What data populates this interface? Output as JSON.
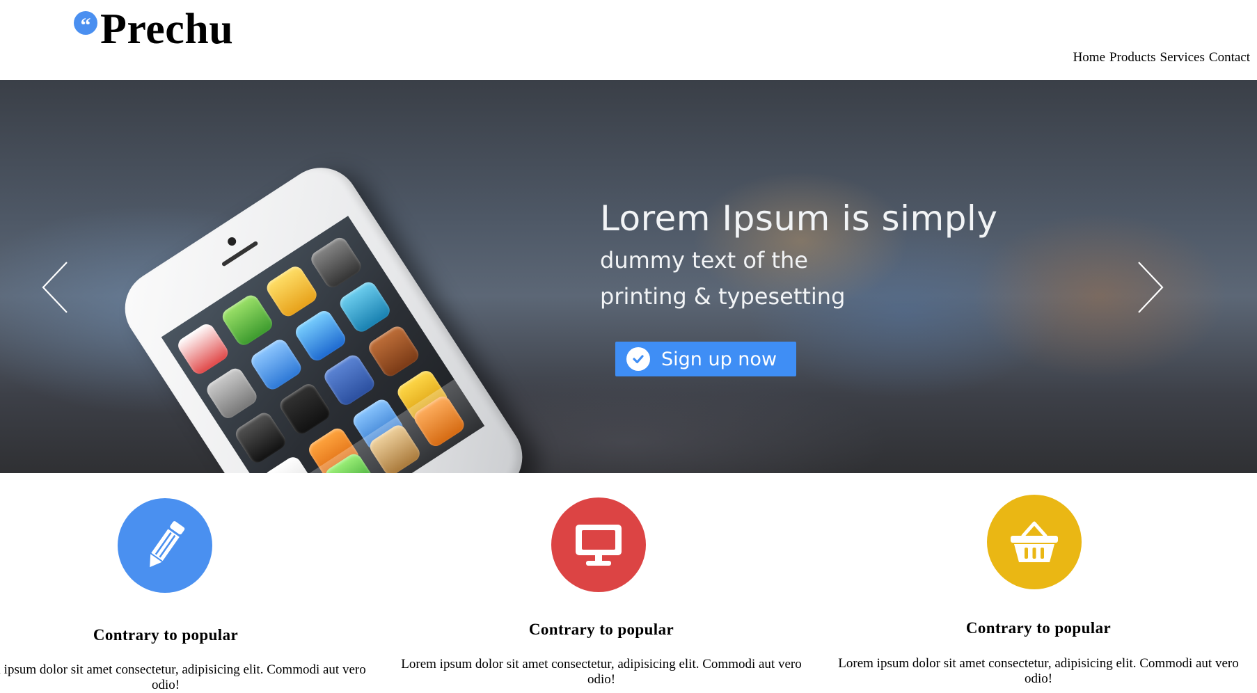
{
  "brand": {
    "mark": "“",
    "name": "Prechu",
    "accent": "#4a8ff0"
  },
  "nav": {
    "items": [
      "Home",
      "Products",
      "Services",
      "Contact"
    ]
  },
  "hero": {
    "title": "Lorem Ipsum is simply",
    "subtitle_line1": "dummy text of the",
    "subtitle_line2": "printing & typesetting",
    "cta_label": "Sign up now",
    "cta_color": "#3f8ef5",
    "prev_icon": "chevron-left-icon",
    "next_icon": "chevron-right-icon"
  },
  "features": [
    {
      "icon": "pencil-icon",
      "color": "#4a90f0",
      "title": "Contrary to popular",
      "text": "Lorem ipsum dolor sit amet consectetur, adipisicing elit. Commodi aut vero odio!"
    },
    {
      "icon": "monitor-icon",
      "color": "#dc4444",
      "title": "Contrary to popular",
      "text": "Lorem ipsum dolor sit amet consectetur, adipisicing elit. Commodi aut vero odio!"
    },
    {
      "icon": "basket-icon",
      "color": "#eab714",
      "title": "Contrary to popular",
      "text": "Lorem ipsum dolor sit amet consectetur, adipisicing elit. Commodi aut vero odio!"
    }
  ]
}
